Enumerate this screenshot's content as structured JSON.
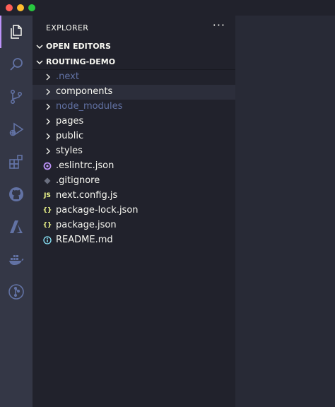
{
  "explorer": {
    "title": "EXPLORER",
    "more": "···",
    "open_editors": "OPEN EDITORS",
    "project": "ROUTING-DEMO"
  },
  "tree": [
    {
      "name": ".next",
      "kind": "folder",
      "dim": true
    },
    {
      "name": "components",
      "kind": "folder",
      "dim": false,
      "selected": true
    },
    {
      "name": "node_modules",
      "kind": "folder",
      "dim": true
    },
    {
      "name": "pages",
      "kind": "folder",
      "dim": false
    },
    {
      "name": "public",
      "kind": "folder",
      "dim": false
    },
    {
      "name": "styles",
      "kind": "folder",
      "dim": false
    },
    {
      "name": ".eslintrc.json",
      "kind": "file",
      "icon": "eslint-icon"
    },
    {
      "name": ".gitignore",
      "kind": "file",
      "icon": "git-icon"
    },
    {
      "name": "next.config.js",
      "kind": "file",
      "icon": "js-icon",
      "icon_text": "JS"
    },
    {
      "name": "package-lock.json",
      "kind": "file",
      "icon": "json-icon",
      "icon_text": "{}"
    },
    {
      "name": "package.json",
      "kind": "file",
      "icon": "json-icon",
      "icon_text": "{}"
    },
    {
      "name": "README.md",
      "kind": "file",
      "icon": "info-icon"
    }
  ],
  "activity_icons": [
    "explorer-icon",
    "search-icon",
    "source-control-icon",
    "run-debug-icon",
    "extensions-icon",
    "github-icon",
    "azure-icon",
    "docker-icon",
    "git-graph-icon"
  ],
  "colors": {
    "accent": "#bd93f9",
    "js": "#f1fa8c",
    "json": "#f1fa8c",
    "eslint": "#bd93f9",
    "info": "#8be9fd"
  }
}
